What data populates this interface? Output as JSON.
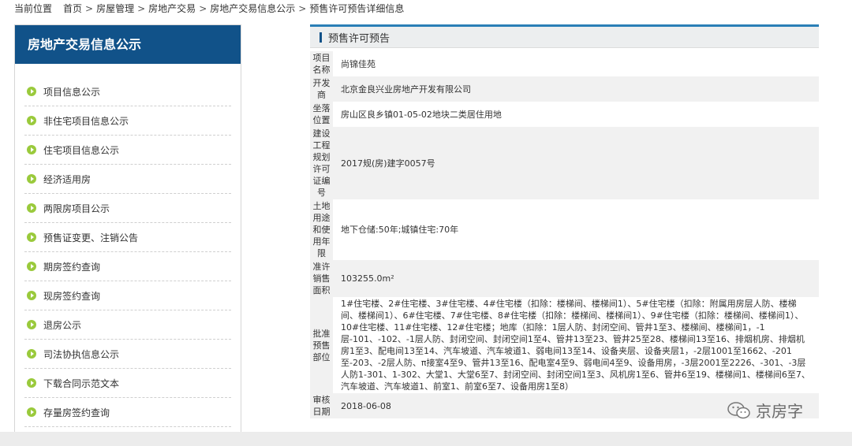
{
  "breadcrumb": [
    "当前位置",
    "首页",
    "房屋管理",
    "房地产交易",
    "房地产交易信息公示",
    "预售许可预告详细信息"
  ],
  "breadcrumb_sep": ">",
  "sidebar": {
    "title": "房地产交易信息公示",
    "items": [
      {
        "label": "项目信息公示"
      },
      {
        "label": "非住宅项目信息公示"
      },
      {
        "label": "住宅项目信息公示"
      },
      {
        "label": "经济适用房"
      },
      {
        "label": "两限房项目公示"
      },
      {
        "label": "预售证变更、注销公告"
      },
      {
        "label": "期房签约查询"
      },
      {
        "label": "现房签约查询"
      },
      {
        "label": "退房公示"
      },
      {
        "label": "司法协执信息公示"
      },
      {
        "label": "下载合同示范文本"
      },
      {
        "label": "存量房签约查询"
      }
    ]
  },
  "panel": {
    "title": "预售许可预告",
    "rows": [
      {
        "label": "项目名称",
        "value": "尚锦佳苑"
      },
      {
        "label": "开发商",
        "value": "北京金良兴业房地产开发有限公司"
      },
      {
        "label": "坐落位置",
        "value": "房山区良乡镇01-05-02地块二类居住用地"
      },
      {
        "label": "建设工程规划许可证编号",
        "value": "2017规(房)建字0057号"
      },
      {
        "label": "土地用途和使用年限",
        "value": "地下仓储:50年;城镇住宅:70年"
      },
      {
        "label": "准许销售面积",
        "value": "103255.0m²"
      },
      {
        "label": "批准预售部位",
        "value": "1#住宅楼、2#住宅楼、3#住宅楼、4#住宅楼（扣除：楼梯间、楼梯间1）、5#住宅楼（扣除：附属用房层人防、楼梯间、楼梯间1）、6#住宅楼、7#住宅楼、8#住宅楼（扣除：楼梯间、楼梯间1）、9#住宅楼（扣除：楼梯间、楼梯间1）、10#住宅楼、11#住宅楼、12#住宅楼；地库（扣除：1层人防、封闭空间、管井1至3、楼梯间、楼梯间1，-1层-101、-102、-1层人防、封闭空间、封闭空间1至4、管井13至23、管井25至28、楼梯间13至16、排烟机房、排烟机房1至3、配电间13至14、汽车坡道、汽车坡道1、弱电间13至14、设备夹层、设备夹层1，-2层1001至1662、-201至-203、-2层人防、π接室4至9、管井13至16、配电室4至9、弱电间4至9、设备用房，-3层2001至2226、-301、-3层人防1-301、1-302、大堂1、大堂6至7、封闭空间、封闭空间1至3、风机房1至6、管井6至19、楼梯间1、楼梯间6至7、汽车坡道、汽车坡道1、前室1、前室6至7、设备用房1至8）"
      },
      {
        "label": "审核日期",
        "value": "2018-06-08"
      }
    ]
  },
  "watermark": {
    "text": "京房字",
    "icon": "wechat-icon"
  },
  "colors": {
    "brand": "#115289",
    "accent": "#2a7fb6",
    "bullet": "#9aca3c"
  }
}
